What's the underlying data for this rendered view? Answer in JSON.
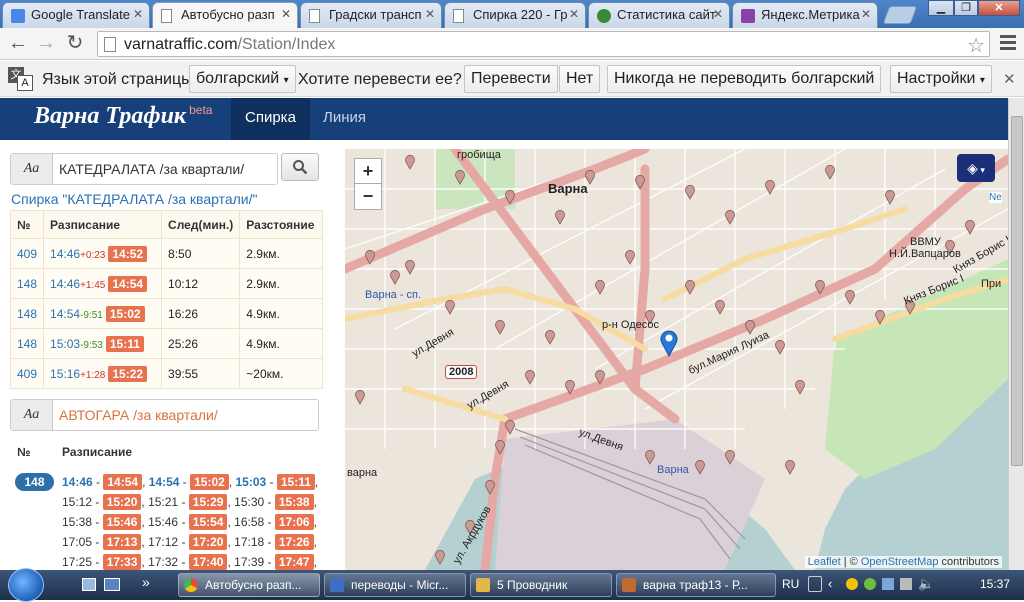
{
  "browser": {
    "tabs": [
      {
        "title": "Google Translate",
        "icon": "google-translate-icon"
      },
      {
        "title": "Автобусно разп",
        "icon": "page-icon"
      },
      {
        "title": "Градски трансп",
        "icon": "page-icon"
      },
      {
        "title": "Спирка 220 - Гр",
        "icon": "page-icon"
      },
      {
        "title": "Статистика сайт",
        "icon": "metrika-bird-icon"
      },
      {
        "title": "Яндекс.Метрика",
        "icon": "metrika-icon"
      }
    ],
    "url_domain": "varnatraffic.com",
    "url_path": "/Station/Index",
    "translate_bar": {
      "prompt": "Язык этой страницы",
      "language": "болгарский",
      "question": "Хотите перевести ее?",
      "translate": "Перевести",
      "no": "Нет",
      "never": "Никогда не переводить болгарский",
      "settings": "Настройки"
    }
  },
  "site": {
    "logo": "Варна Трафик",
    "logo_sup": "beta",
    "nav": [
      "Спирка",
      "Линия"
    ]
  },
  "search1": {
    "aa": "Aa",
    "value": "КАТЕДРАЛАТА /за квартали/"
  },
  "stop_title": "Спирка \"КАТЕДРАЛАТА /за квартали/\"",
  "table": {
    "headers": [
      "№",
      "Разписание",
      "След(мин.)",
      "Разстояние"
    ],
    "rows": [
      {
        "line": "409",
        "sched": "14:46",
        "delta": "+0:23",
        "dclass": "neg",
        "actual": "14:52",
        "next": "8:50",
        "dist": "2.9км."
      },
      {
        "line": "148",
        "sched": "14:46",
        "delta": "+1:45",
        "dclass": "neg",
        "actual": "14:54",
        "next": "10:12",
        "dist": "2.9км."
      },
      {
        "line": "148",
        "sched": "14:54",
        "delta": "-9:51",
        "dclass": "pos",
        "actual": "15:02",
        "next": "16:26",
        "dist": "4.9км."
      },
      {
        "line": "148",
        "sched": "15:03",
        "delta": "-9:53",
        "dclass": "pos",
        "actual": "15:11",
        "next": "25:26",
        "dist": "4.9км."
      },
      {
        "line": "409",
        "sched": "15:16",
        "delta": "+1:28",
        "dclass": "neg",
        "actual": "15:22",
        "next": "39:55",
        "dist": "~20км."
      }
    ]
  },
  "search2": {
    "aa": "Aa",
    "value": "АВТОГАРА /за квартали/"
  },
  "section2": {
    "headers": [
      "№",
      "Разписание"
    ],
    "line": "148",
    "rows": [
      [
        [
          "14:46",
          "14:54"
        ],
        [
          "14:54",
          "15:02"
        ],
        [
          "15:03",
          "15:11"
        ]
      ],
      [
        [
          "15:12",
          "15:20"
        ],
        [
          "15:21",
          "15:29"
        ],
        [
          "15:30",
          "15:38"
        ]
      ],
      [
        [
          "15:38",
          "15:46"
        ],
        [
          "15:46",
          "15:54"
        ],
        [
          "16:58",
          "17:06"
        ]
      ],
      [
        [
          "17:05",
          "17:13"
        ],
        [
          "17:12",
          "17:20"
        ],
        [
          "17:18",
          "17:26"
        ]
      ],
      [
        [
          "17:25",
          "17:33"
        ],
        [
          "17:32",
          "17:40"
        ],
        [
          "17:39",
          "17:47"
        ]
      ]
    ]
  },
  "map": {
    "zoom_in": "+",
    "zoom_out": "−",
    "labels": [
      "Варна",
      "гробища",
      "ВВМУ",
      "Н.Й.Вапцаров",
      "р-н Одесос",
      "бул.Мария Луиза",
      "ул.Девня",
      "ул.Девня",
      "ул.Девня",
      "Варна - сп.",
      "Княз Борис I",
      "Княз Борис I",
      "ул. Акрдуков",
      "2008",
      "Варна",
      "При",
      "варна",
      "Ne"
    ],
    "attribution_leaflet": "Leaflet",
    "attribution_sep": " | © ",
    "attribution_osm": "OpenStreetMap",
    "attribution_tail": " contributors"
  },
  "taskbar": {
    "tasks": [
      {
        "label": "Автобусно разп...",
        "color": "#e44b3c"
      },
      {
        "label": "переводы - Micr...",
        "color": "#3d6fc2"
      },
      {
        "label": "5 Проводник",
        "color": "#e2b84a"
      },
      {
        "label": "варна траф13 - Р...",
        "color": "#c26a2e"
      }
    ],
    "lang": "RU",
    "clock": "15:37"
  }
}
